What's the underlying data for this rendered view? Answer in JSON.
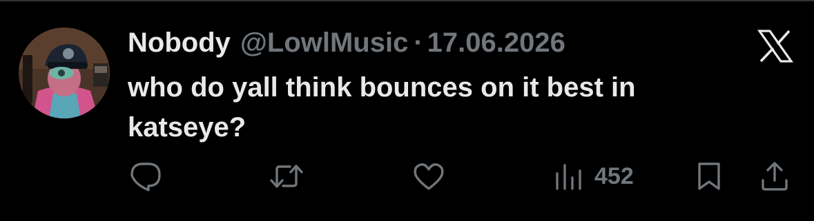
{
  "tweet": {
    "display_name": "Nobody",
    "handle": "@LowlMusic",
    "separator": "·",
    "date": "17.06.2026",
    "text": "who do yall think bounces on it best in katseye?"
  },
  "actions": {
    "views_count": "452"
  },
  "icons": {
    "brand": "x-logo-icon",
    "reply": "reply-icon",
    "retweet": "retweet-icon",
    "like": "heart-icon",
    "views": "views-bar-chart-icon",
    "bookmark": "bookmark-icon",
    "share": "share-icon"
  },
  "colors": {
    "background": "#000000",
    "primary_text": "#e7e9ea",
    "secondary_text": "#71767b"
  }
}
